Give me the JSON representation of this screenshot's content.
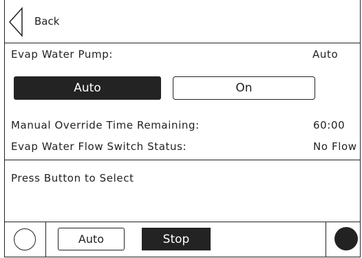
{
  "nav": {
    "back_label": "Back"
  },
  "pump": {
    "label": "Evap Water Pump:",
    "value": "Auto",
    "buttons": {
      "auto": "Auto",
      "on": "On"
    }
  },
  "override": {
    "label": "Manual Override Time Remaining:",
    "value": "60:00"
  },
  "flow_switch": {
    "label": "Evap Water Flow Switch Status:",
    "value": "No Flow"
  },
  "message": "Press Button to Select",
  "footer": {
    "auto_label": "Auto",
    "stop_label": "Stop"
  },
  "colors": {
    "dark": "#232323",
    "background": "#ffffff",
    "line": "#222222"
  }
}
